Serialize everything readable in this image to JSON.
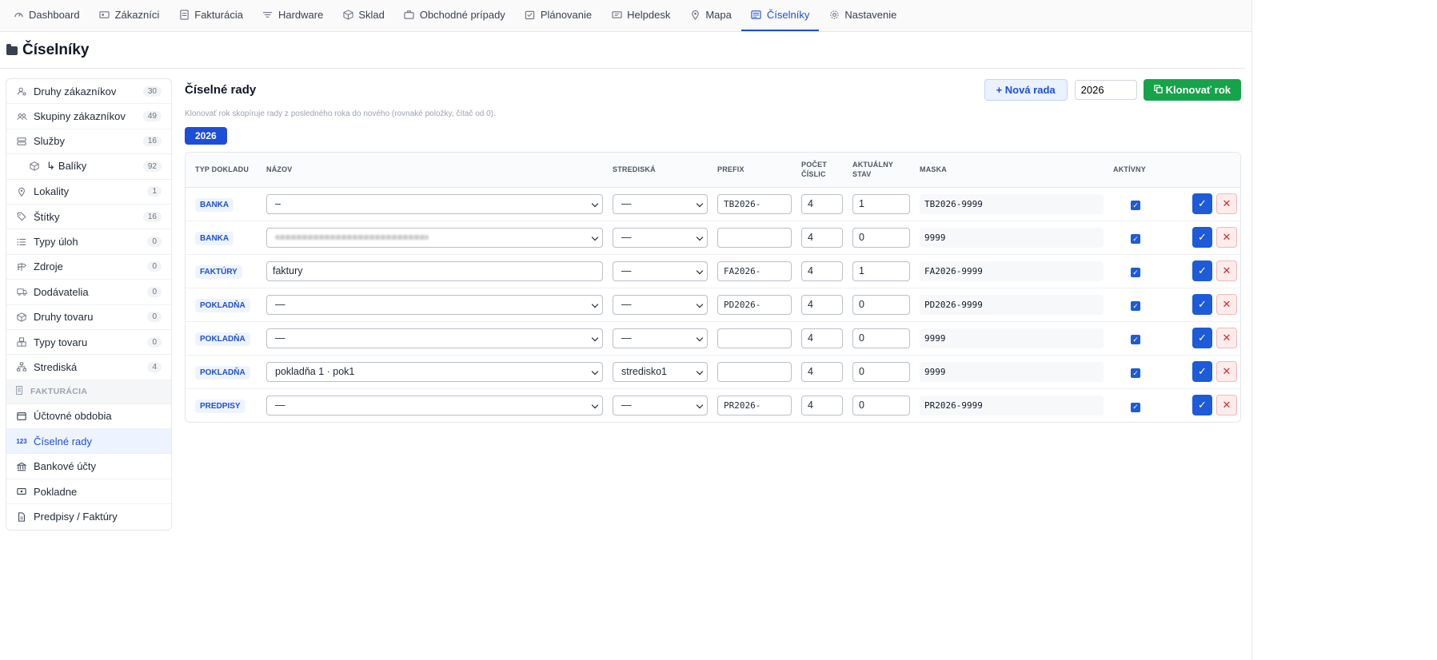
{
  "nav": [
    {
      "label": "Dashboard",
      "icon": "dashboard-icon"
    },
    {
      "label": "Zákazníci",
      "icon": "customers-icon"
    },
    {
      "label": "Fakturácia",
      "icon": "invoice-icon"
    },
    {
      "label": "Hardware",
      "icon": "hardware-icon"
    },
    {
      "label": "Sklad",
      "icon": "box-icon"
    },
    {
      "label": "Obchodné prípady",
      "icon": "briefcase-icon"
    },
    {
      "label": "Plánovanie",
      "icon": "calendar-icon"
    },
    {
      "label": "Helpdesk",
      "icon": "ticket-icon"
    },
    {
      "label": "Mapa",
      "icon": "map-pin-icon"
    },
    {
      "label": "Číselníky",
      "icon": "list-icon"
    },
    {
      "label": "Nastavenie",
      "icon": "gear-icon"
    }
  ],
  "page": {
    "title": "Číselníky"
  },
  "sidebar": {
    "items": [
      {
        "label": "Druhy zákazníkov",
        "count": "30"
      },
      {
        "label": "Skupiny zákazníkov",
        "count": "49"
      },
      {
        "label": "Služby",
        "count": "16"
      },
      {
        "label": "Balíky",
        "count": "92"
      },
      {
        "label": "Lokality",
        "count": "1"
      },
      {
        "label": "Štítky",
        "count": "16"
      },
      {
        "label": "Typy úloh",
        "count": "0"
      },
      {
        "label": "Zdroje",
        "count": "0"
      },
      {
        "label": "Dodávatelia",
        "count": "0"
      },
      {
        "label": "Druhy tovaru",
        "count": "0"
      },
      {
        "label": "Typy tovaru",
        "count": "0"
      },
      {
        "label": "Strediská",
        "count": "4"
      }
    ],
    "section_label": "FAKTURÁCIA",
    "section_items": [
      {
        "label": "Účtovné obdobia"
      },
      {
        "label": "Číselné rady",
        "icon_text": "123"
      },
      {
        "label": "Bankové účty"
      },
      {
        "label": "Pokladne"
      },
      {
        "label": "Predpisy / Faktúry"
      }
    ]
  },
  "main": {
    "title": "Číselné rady",
    "new_button": "+ Nová rada",
    "year_value": "2026",
    "clone_button": "Klonovať rok",
    "hint": "Klonovať rok skopíruje rady z posledného roka do nového (rovnaké položky, čítač od 0).",
    "year_chip": "2026"
  },
  "table": {
    "headers": [
      "TYP DOKLADU",
      "NÁZOV",
      "STREDISKÁ",
      "PREFIX",
      "POČET ČÍSLIC",
      "AKTUÁLNY STAV",
      "MASKA",
      "AKTÍVNY"
    ],
    "rows": [
      {
        "type": "BANKA",
        "name": "–",
        "name_kind": "select",
        "stredisko": "—",
        "prefix": "TB2026-",
        "digits": "4",
        "state": "1",
        "mask": "TB2026-9999"
      },
      {
        "type": "BANKA",
        "name": "",
        "name_kind": "select-blurred",
        "stredisko": "—",
        "prefix": "",
        "digits": "4",
        "state": "0",
        "mask": "9999"
      },
      {
        "type": "FAKTÚRY",
        "name": "faktury",
        "name_kind": "input",
        "stredisko": "—",
        "prefix": "FA2026-",
        "digits": "4",
        "state": "1",
        "mask": "FA2026-9999"
      },
      {
        "type": "POKLADŇA",
        "name": "—",
        "name_kind": "select",
        "stredisko": "—",
        "prefix": "PD2026-",
        "digits": "4",
        "state": "0",
        "mask": "PD2026-9999"
      },
      {
        "type": "POKLADŇA",
        "name": "—",
        "name_kind": "select",
        "stredisko": "—",
        "prefix": "",
        "digits": "4",
        "state": "0",
        "mask": "9999"
      },
      {
        "type": "POKLADŇA",
        "name": "pokladňa 1 · pok1",
        "name_kind": "select",
        "stredisko": "stredisko1",
        "prefix": "",
        "digits": "4",
        "state": "0",
        "mask": "9999"
      },
      {
        "type": "PREDPISY",
        "name": "—",
        "name_kind": "select",
        "stredisko": "—",
        "prefix": "PR2026-",
        "digits": "4",
        "state": "0",
        "mask": "PR2026-9999"
      }
    ]
  },
  "colors": {
    "accent": "#1d4ed8",
    "success": "#16a34a",
    "danger": "#dc2626"
  }
}
